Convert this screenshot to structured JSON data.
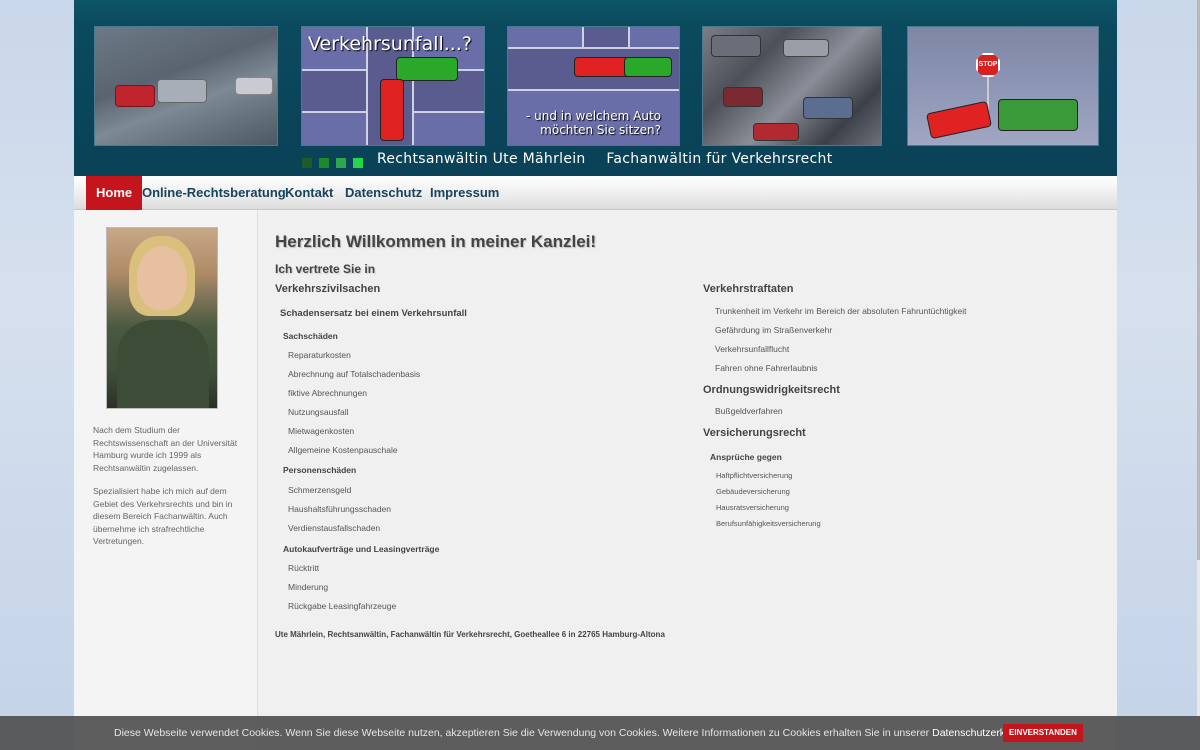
{
  "header": {
    "img2_caption": "Verkehrsunfall...?",
    "img3_caption": "- und in welchem Auto möchten Sie sitzen?",
    "stop_sign": "STOP",
    "square_colors": [
      "#1e5a2a",
      "#1a8a2a",
      "#2aa84a",
      "#22d84a"
    ],
    "tagline_name": "Rechtsanwältin Ute Mährlein",
    "tagline_title": "Fachanwältin für Verkehrsrecht"
  },
  "nav": {
    "items": [
      {
        "label": "Home"
      },
      {
        "label": "Online-Rechtsberatung"
      },
      {
        "label": "Kontakt"
      },
      {
        "label": "Datenschutz"
      },
      {
        "label": "Impressum"
      }
    ],
    "accent": "#c4141c"
  },
  "sidebar": {
    "para1": "Nach dem Studium der Rechtswissenschaft an der Universität Hamburg wurde ich 1999 als Rechtsanwältin zugelassen.",
    "para2": "Spezialisiert habe ich mich auf dem Gebiet des Verkehrsrechts und bin in diesem Bereich Fachanwältin. Auch übernehme ich strafrechtliche Vertretungen."
  },
  "main": {
    "welcome": "Herzlich Willkommen in meiner Kanzlei!",
    "intro": "Ich vertrete Sie in",
    "left": {
      "heading": "Verkehrszivilsachen",
      "subheading": "Schadensersatz bei einem Verkehrsunfall",
      "sach_heading": "Sachschäden",
      "sach_items": [
        "Reparaturkosten",
        "Abrechnung auf Totalschadenbasis",
        "fiktive Abrechnungen",
        "Nutzungsausfall",
        "Mietwagenkosten",
        "Allgemeine Kostenpauschale"
      ],
      "personen_heading": "Personenschäden",
      "personen_items": [
        "Schmerzensgeld",
        "Haushaltsführungsschaden",
        "Verdienstausfallschaden"
      ],
      "autokauf_heading": "Autokaufverträge und Leasingverträge",
      "autokauf_items": [
        "Rücktritt",
        "Minderung",
        "Rückgabe Leasingfahrzeuge"
      ]
    },
    "right": {
      "straf_heading": "Verkehrstraftaten",
      "straf_items": [
        "Trunkenheit im Verkehr im Bereich der absoluten Fahruntüchtigkeit",
        "Gefährdung im Straßenverkehr",
        "Verkehrsunfallflucht",
        "Fahren ohne Fahrerlaubnis"
      ],
      "owi_heading": "Ordnungswidrigkeitsrecht",
      "owi_items": [
        "Bußgeldverfahren"
      ],
      "vers_heading": "Versicherungsrecht",
      "vers_sub": "Ansprüche gegen",
      "vers_items": [
        "Haftpflichtversicherung",
        "Gebäudeversicherung",
        "Hausratsversicherung",
        "Berufsunfähigkeitsversicherung"
      ]
    },
    "footer_line": "Ute Mährlein, Rechtsanwältin, Fachanwältin für Verkehrsrecht, Goetheallee 6 in 22765 Hamburg-Altona"
  },
  "cookie": {
    "text": "Diese Webseite verwendet Cookies. Wenn Sie diese Webseite nutzen, akzeptieren Sie die Verwendung von Cookies. Weitere Informationen zu Cookies erhalten Sie in unserer",
    "link": "Datenschutzerklärung",
    "button": "EINVERSTANDEN"
  }
}
